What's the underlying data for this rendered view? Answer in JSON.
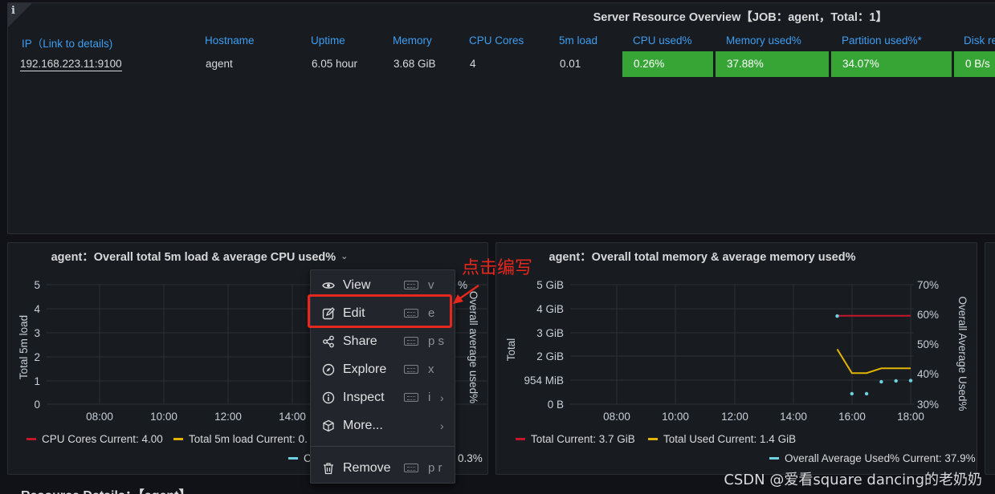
{
  "top_panel": {
    "info_icon": "i",
    "title": "Server Resource Overview【JOB：agent，Total：1】",
    "columns": [
      "IP（Link to details)",
      "Hostname",
      "Uptime",
      "Memory",
      "CPU Cores",
      "5m load",
      "CPU used%",
      "Memory used%",
      "Partition used%*",
      "Disk re"
    ],
    "row": {
      "ip": "192.168.223.11:9100",
      "hostname": "agent",
      "uptime": "6.05 hour",
      "memory": "3.68 GiB",
      "cpu_cores": "4",
      "load5m": "0.01",
      "cpu_used": "0.26%",
      "memory_used": "37.88%",
      "partition_used": "34.07%",
      "disk_read": "0 B/s"
    },
    "good_color": "#37a536"
  },
  "cpu_panel": {
    "title": "agent：Overall total 5m load & average CPU used%",
    "chevron": "⌄",
    "left_axis_label": "Total 5m load",
    "right_axis_label": "Overall average used%",
    "y_ticks": [
      "5",
      "4",
      "3",
      "2",
      "1",
      "0"
    ],
    "right_tick_partial": "%",
    "x_ticks": [
      "08:00",
      "10:00",
      "12:00",
      "14:00"
    ],
    "legend": {
      "cpu_cores": "CPU Cores  Current: 4.00",
      "total_load": "Total 5m load  Current: 0.",
      "avg_prefix": "C",
      "avg_suffix": "0.3%"
    }
  },
  "mem_panel": {
    "title": "agent：Overall total memory & average memory used%",
    "left_axis_label": "Total",
    "right_axis_label": "Overall Average Used%",
    "y_ticks": [
      "5 GiB",
      "4 GiB",
      "3 GiB",
      "2 GiB",
      "954 MiB",
      "0 B"
    ],
    "right_ticks": [
      "70%",
      "60%",
      "50%",
      "40%",
      "30%"
    ],
    "x_ticks": [
      "08:00",
      "10:00",
      "12:00",
      "14:00",
      "16:00",
      "18:00"
    ],
    "legend": {
      "total": "Total  Current: 3.7 GiB",
      "total_used": "Total Used  Current: 1.4 GiB",
      "avg_used": "Overall Average Used%  Current: 37.9%"
    }
  },
  "chart_data": [
    {
      "type": "line",
      "title": "agent：Overall total 5m load & average CPU used%",
      "ylabel": "Total 5m load",
      "y2label": "Overall average used%",
      "ylim": [
        0,
        5
      ],
      "x_ticks": [
        "08:00",
        "10:00",
        "12:00",
        "14:00"
      ],
      "series": [
        {
          "name": "CPU Cores",
          "current": 4.0
        },
        {
          "name": "Total 5m load"
        }
      ]
    },
    {
      "type": "line",
      "title": "agent：Overall total memory & average memory used%",
      "ylabel": "Total",
      "y2label": "Overall Average Used%",
      "y_ticks": [
        "0 B",
        "954 MiB",
        "2 GiB",
        "3 GiB",
        "4 GiB",
        "5 GiB"
      ],
      "y2lim": [
        30,
        70
      ],
      "x_ticks": [
        "08:00",
        "10:00",
        "12:00",
        "14:00",
        "16:00",
        "18:00"
      ],
      "series": [
        {
          "name": "Total",
          "x": [
            "15:30",
            "18:00"
          ],
          "values_gib": [
            3.7,
            3.7
          ]
        },
        {
          "name": "Total Used",
          "x": [
            "15:30",
            "16:00",
            "16:30",
            "17:00",
            "18:00"
          ],
          "values_gib": [
            2.3,
            1.3,
            1.3,
            1.5,
            1.5
          ]
        },
        {
          "name": "Overall Average Used%",
          "x": [
            "15:30",
            "16:00",
            "16:30",
            "17:00",
            "17:30",
            "18:00"
          ],
          "values": [
            59.5,
            33.5,
            33.5,
            37.5,
            37.8,
            37.9
          ]
        }
      ]
    }
  ],
  "context_menu": {
    "items": [
      {
        "label": "View",
        "shortcut": "v"
      },
      {
        "label": "Edit",
        "shortcut": "e"
      },
      {
        "label": "Share",
        "shortcut": "p s"
      },
      {
        "label": "Explore",
        "shortcut": "x"
      },
      {
        "label": "Inspect",
        "shortcut": "i"
      },
      {
        "label": "More..."
      },
      {
        "label": "Remove",
        "shortcut": "p r"
      }
    ]
  },
  "annotation": {
    "text": "点击编写",
    "color": "#e5271e"
  },
  "bottom_section": {
    "title": "Resource Details：【agent】"
  },
  "watermark": "CSDN @爱看square dancing的老奶奶"
}
